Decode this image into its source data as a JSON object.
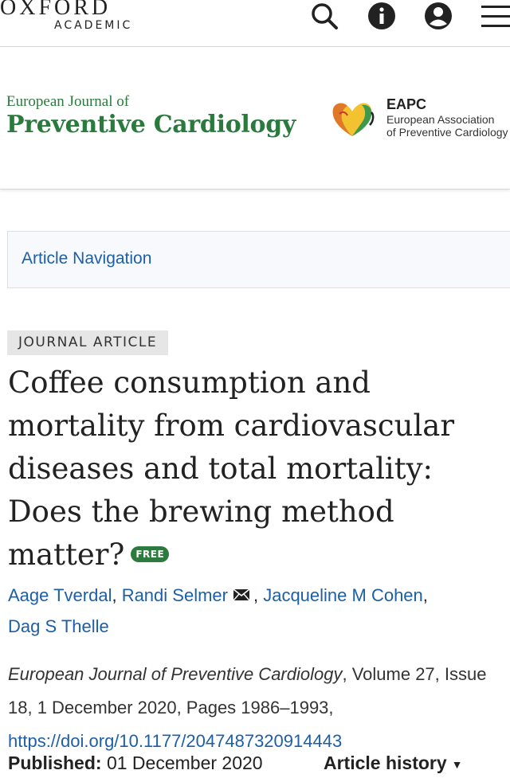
{
  "header": {
    "logo_line1": "OXFORD",
    "logo_line2": "ACADEMIC",
    "icons": [
      "search-icon",
      "info-icon",
      "account-icon",
      "menu-icon"
    ]
  },
  "journal": {
    "name_small": "European Journal of",
    "name_big": "Preventive Cardiology",
    "society_abbr": "EAPC",
    "society_line1": "European Association",
    "society_line2": "of Preventive Cardiology",
    "brand_color": "#2b7a3d"
  },
  "nav": {
    "article_navigation": "Article Navigation"
  },
  "article": {
    "type": "JOURNAL ARTICLE",
    "title": "Coffee consumption and mortality from cardiovascular diseases and total mortality: Does the brewing method matter?",
    "free_badge": "FREE",
    "authors": [
      "Aage Tverdal",
      "Randi Selmer",
      "Jacqueline M Cohen",
      "Dag S Thelle"
    ],
    "journal_name": "European Journal of Preventive Cardiology",
    "citation_rest": ", Volume 27, Issue 18, 1 December 2020, Pages 1986–1993,",
    "doi": "https://doi.org/10.1177/2047487320914443",
    "published_label": "Published:",
    "published_date": "01 December 2020",
    "history_label": "Article history",
    "link_color": "#1d5fa6"
  }
}
